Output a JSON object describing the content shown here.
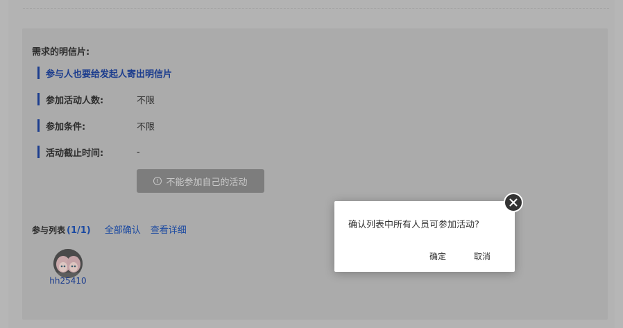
{
  "section_title": "需求的明信片:",
  "highlight_row": "参与人也要给发起人寄出明信片",
  "rows": [
    {
      "label": "参加活动人数:",
      "value": "不限"
    },
    {
      "label": "参加条件:",
      "value": "不限"
    },
    {
      "label": "活动截止时间:",
      "value": "-"
    }
  ],
  "disabled_button_label": "不能参加自己的活动",
  "participants": {
    "title": "参与列表",
    "count": "(1/1)",
    "confirm_all": "全部确认",
    "view_details": "查看详细",
    "user": "hh25410"
  },
  "dialog": {
    "message": "确认列表中所有人员可参加活动?",
    "ok": "确定",
    "cancel": "取消"
  },
  "colors": {
    "accent": "#1c3d8e",
    "link": "#1c4aa1",
    "overlay_bg": "#b3b3b3",
    "dialog_bg": "#ffffff",
    "close_btn": "#333333"
  },
  "icons": {
    "disabled_button": "info-circle-icon",
    "dialog_close": "close-icon"
  }
}
